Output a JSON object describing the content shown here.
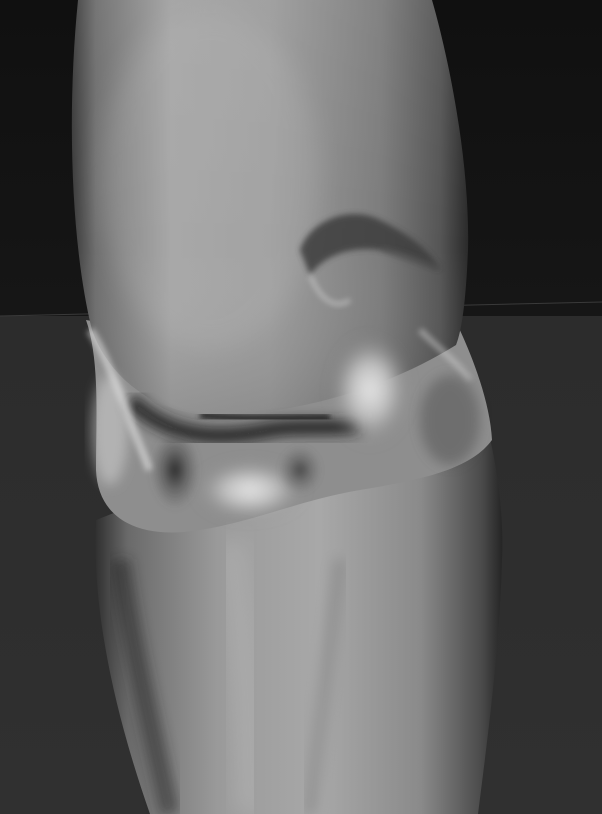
{
  "scene": {
    "subject": "sculpted-limb-render",
    "background_top": "#121212",
    "background_bottom": "#2e2e2e",
    "horizon_line": "#3a3a3a",
    "surface_light": "#d8d8d8",
    "surface_mid": "#9a9a9a",
    "surface_dark": "#4a4a4a"
  }
}
